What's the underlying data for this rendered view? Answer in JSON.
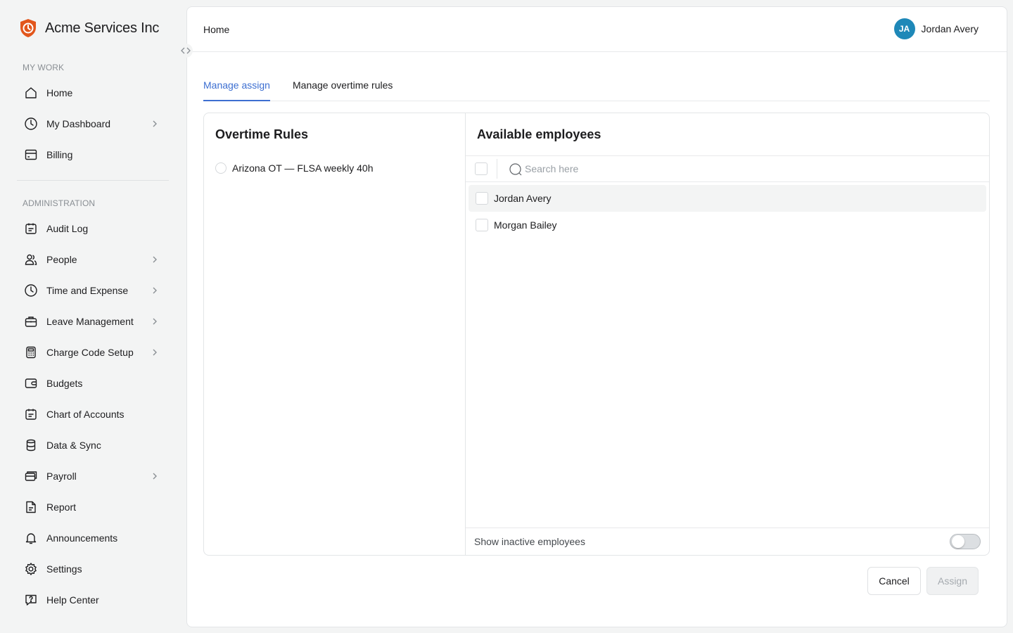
{
  "app": {
    "name": "Acme Services Inc",
    "accent": "#3d6fd1",
    "brand_color": "#e2561c"
  },
  "sidebar": {
    "sections": [
      {
        "label": "MY WORK"
      },
      {
        "label": "ADMINISTRATION"
      }
    ],
    "my_work": [
      {
        "label": "Home",
        "icon": "home-icon",
        "chevron": false
      },
      {
        "label": "My Dashboard",
        "icon": "clock-icon",
        "chevron": true
      },
      {
        "label": "Billing",
        "icon": "billing-icon",
        "chevron": false
      }
    ],
    "admin": [
      {
        "label": "Audit Log",
        "icon": "calendar-icon",
        "chevron": false
      },
      {
        "label": "People",
        "icon": "people-icon",
        "chevron": true
      },
      {
        "label": "Time and Expense",
        "icon": "clock-icon",
        "chevron": true
      },
      {
        "label": "Leave Management",
        "icon": "briefcase-icon",
        "chevron": true
      },
      {
        "label": "Charge Code Setup",
        "icon": "calculator-icon",
        "chevron": true
      },
      {
        "label": "Budgets",
        "icon": "wallet-icon",
        "chevron": false
      },
      {
        "label": "Chart of Accounts",
        "icon": "calendar-icon",
        "chevron": false
      },
      {
        "label": "Data & Sync",
        "icon": "database-icon",
        "chevron": false
      },
      {
        "label": "Payroll",
        "icon": "payroll-icon",
        "chevron": true
      },
      {
        "label": "Report",
        "icon": "report-icon",
        "chevron": false
      },
      {
        "label": "Announcements",
        "icon": "bell-icon",
        "chevron": false
      },
      {
        "label": "Settings",
        "icon": "gear-icon",
        "chevron": false
      },
      {
        "label": "Help Center",
        "icon": "help-icon",
        "chevron": false
      }
    ]
  },
  "header": {
    "breadcrumb": "Home",
    "user": {
      "initials": "JA",
      "name": "Jordan Avery",
      "avatar_color": "#1e88b8"
    }
  },
  "tabs": [
    {
      "label": "Manage assign",
      "active": true
    },
    {
      "label": "Manage overtime rules",
      "active": false
    }
  ],
  "overtime_rules": {
    "title": "Overtime Rules",
    "items": [
      {
        "label": "Arizona OT — FLSA weekly 40h",
        "selected": false
      }
    ]
  },
  "employees": {
    "title": "Available employees",
    "search_placeholder": "Search here",
    "search_value": "",
    "items": [
      {
        "name": "Jordan Avery",
        "checked": false
      },
      {
        "name": "Morgan Bailey",
        "checked": false
      }
    ],
    "show_inactive_label": "Show inactive employees",
    "show_inactive": false
  },
  "actions": {
    "cancel_label": "Cancel",
    "assign_label": "Assign",
    "assign_disabled": true
  }
}
